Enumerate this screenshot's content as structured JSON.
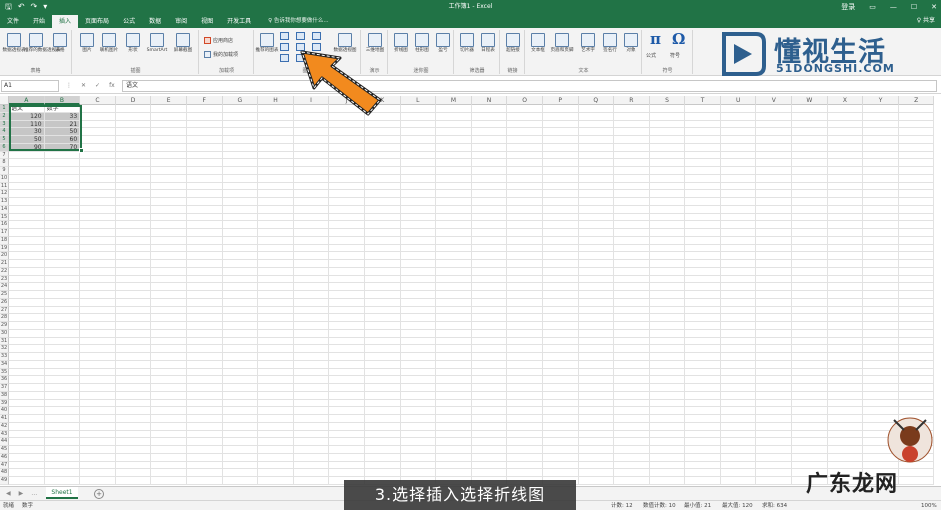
{
  "window": {
    "title": "工作簿1 - Excel",
    "controls": [
      "登录",
      "▭",
      "—",
      "☐",
      "✕"
    ]
  },
  "tabs": [
    "文件",
    "开始",
    "插入",
    "页面布局",
    "公式",
    "数据",
    "审阅",
    "视图",
    "开发工具"
  ],
  "active_tab": "插入",
  "tell_me": "♀ 告诉我你想要做什么...",
  "share": "♀ 共享",
  "ribbon": {
    "groups": [
      {
        "label": "表格",
        "buttons": [
          "数据透视表",
          "推荐的数据透视表",
          "表格"
        ]
      },
      {
        "label": "插图",
        "buttons": [
          "图片",
          "联机图片",
          "形状",
          "SmartArt",
          "屏幕截图"
        ]
      },
      {
        "label": "加载项",
        "buttons": [
          "应用商店",
          "我的加载项"
        ]
      },
      {
        "label": "图表",
        "buttons": [
          "推荐的图表",
          "数据透视图"
        ]
      },
      {
        "label": "演示",
        "buttons": [
          "三维地图"
        ]
      },
      {
        "label": "迷你图",
        "buttons": [
          "折线图",
          "柱形图",
          "盈亏"
        ]
      },
      {
        "label": "筛选器",
        "buttons": [
          "切片器",
          "日程表"
        ]
      },
      {
        "label": "链接",
        "buttons": [
          "超链接"
        ]
      },
      {
        "label": "文本",
        "buttons": [
          "文本框",
          "页眉和页脚",
          "艺术字",
          "签名行",
          "对象"
        ]
      },
      {
        "label": "符号",
        "buttons": [
          "公式",
          "符号"
        ]
      }
    ]
  },
  "logo": {
    "cn": "懂视生活",
    "en": "51DONGSHI.COM"
  },
  "formula_bar": {
    "name_box": "A1",
    "buttons": [
      "⋮",
      "✕",
      "✓",
      "fx"
    ],
    "content": "语文"
  },
  "columns": [
    "A",
    "B",
    "C",
    "D",
    "E",
    "F",
    "G",
    "H",
    "I",
    "J",
    "K",
    "L",
    "M",
    "N",
    "O",
    "P",
    "Q",
    "R",
    "S",
    "T",
    "U",
    "V",
    "W",
    "X",
    "Y",
    "Z"
  ],
  "rows": [
    {
      "n": "1",
      "cells": [
        "语文",
        "数学"
      ]
    },
    {
      "n": "2",
      "cells": [
        "120",
        "33"
      ]
    },
    {
      "n": "3",
      "cells": [
        "110",
        "21"
      ]
    },
    {
      "n": "4",
      "cells": [
        "30",
        "50"
      ]
    },
    {
      "n": "5",
      "cells": [
        "50",
        "60"
      ]
    },
    {
      "n": "6",
      "cells": [
        "90",
        "70"
      ]
    },
    {
      "n": "7"
    },
    {
      "n": "8"
    },
    {
      "n": "9"
    },
    {
      "n": "10"
    },
    {
      "n": "11"
    },
    {
      "n": "12"
    },
    {
      "n": "13"
    },
    {
      "n": "14"
    },
    {
      "n": "15"
    },
    {
      "n": "16"
    },
    {
      "n": "17"
    },
    {
      "n": "18"
    },
    {
      "n": "19"
    },
    {
      "n": "20"
    },
    {
      "n": "21"
    },
    {
      "n": "22"
    },
    {
      "n": "23"
    },
    {
      "n": "24"
    },
    {
      "n": "25"
    },
    {
      "n": "26"
    },
    {
      "n": "27"
    },
    {
      "n": "28"
    },
    {
      "n": "29"
    },
    {
      "n": "30"
    },
    {
      "n": "31"
    },
    {
      "n": "32"
    },
    {
      "n": "33"
    },
    {
      "n": "34"
    },
    {
      "n": "35"
    },
    {
      "n": "36"
    },
    {
      "n": "37"
    },
    {
      "n": "38"
    },
    {
      "n": "39"
    },
    {
      "n": "40"
    },
    {
      "n": "41"
    },
    {
      "n": "42"
    },
    {
      "n": "43"
    },
    {
      "n": "44"
    },
    {
      "n": "45"
    },
    {
      "n": "46"
    },
    {
      "n": "47"
    },
    {
      "n": "48"
    },
    {
      "n": "49"
    }
  ],
  "sheet": {
    "tab": "Sheet1",
    "add": "+",
    "nav": [
      "◀",
      "▶",
      "…"
    ]
  },
  "status": {
    "left": [
      "就绪",
      "数字"
    ],
    "count": "计数: 12",
    "numeric_count": "数值计数: 10",
    "min": "最小值: 21",
    "max": "最大值: 120",
    "sum": "求和: 634",
    "zoom": "100%"
  },
  "caption": "3.选择插入选择折线图",
  "watermark": "广东龙网",
  "colors": {
    "excel_green": "#217346",
    "arrow_orange": "#f28a1e",
    "logo_blue": "#2e5f8e"
  }
}
